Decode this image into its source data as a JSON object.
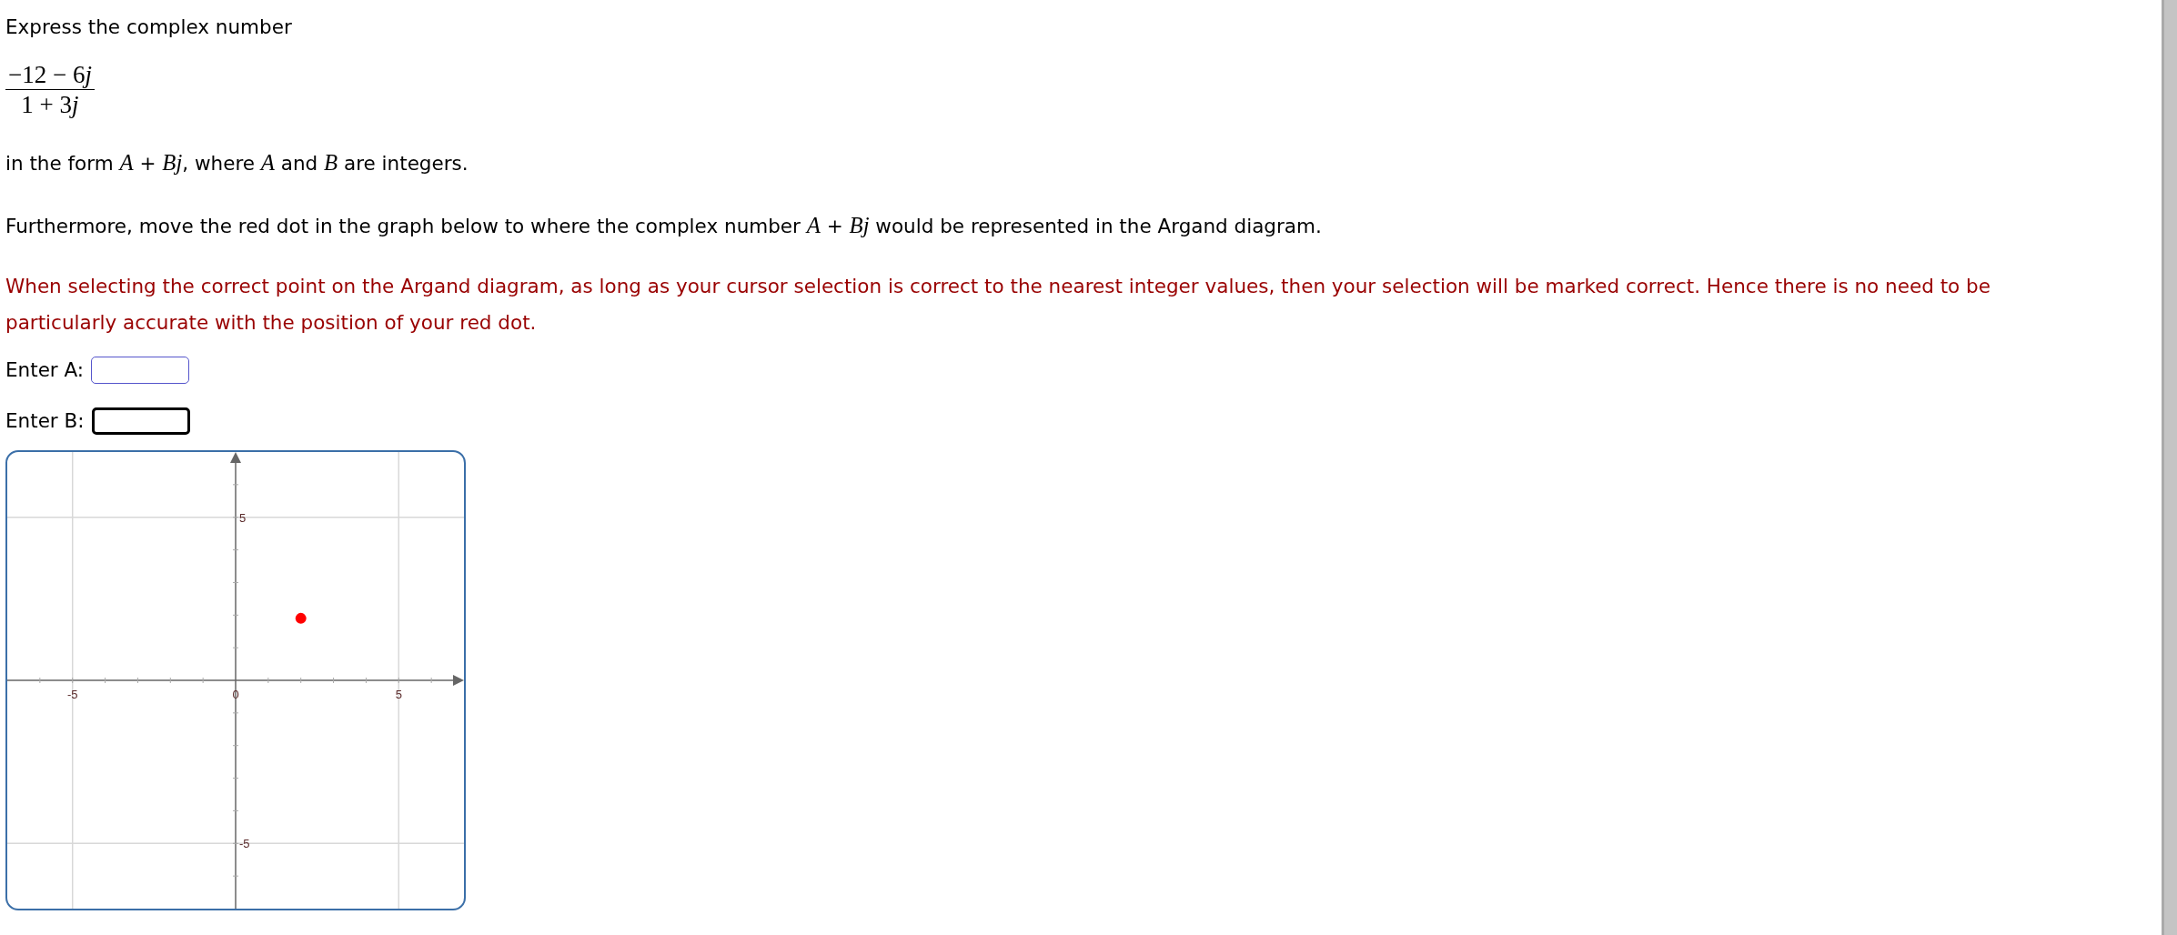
{
  "intro": "Express the complex number",
  "fraction": {
    "numerator": [
      {
        "kind": "number",
        "text": "−12 − 6"
      },
      {
        "kind": "variable",
        "text": "j"
      }
    ],
    "denominator": [
      {
        "kind": "number",
        "text": "1 + 3"
      },
      {
        "kind": "variable",
        "text": "j"
      }
    ]
  },
  "form_text": "in the form *A* + *Bj*, where *A* and *B* are integers.",
  "instruction": "Furthermore, move the red dot in the graph below to where the complex number *A* + *Bj* would be represented in the Argand diagram.",
  "note": "When selecting the correct point on the Argand diagram, as long as your cursor selection is correct to the nearest integer values, then your selection will be marked correct. Hence there is no need to be particularly accurate with the position of your red dot.",
  "fields": [
    {
      "label": "Enter A:",
      "focused": false
    },
    {
      "label": "Enter B:",
      "focused": true
    }
  ],
  "graph": {
    "chart_data": {
      "type": "scatter",
      "grid": true,
      "xlim": [
        -7,
        7
      ],
      "ylim": [
        -7,
        7
      ],
      "xticks": [
        -5,
        0,
        5
      ],
      "yticks": [
        -5,
        5
      ],
      "series": [
        {
          "color": "#ff0000",
          "x": [
            2
          ],
          "values": [
            1.9
          ]
        }
      ]
    }
  }
}
